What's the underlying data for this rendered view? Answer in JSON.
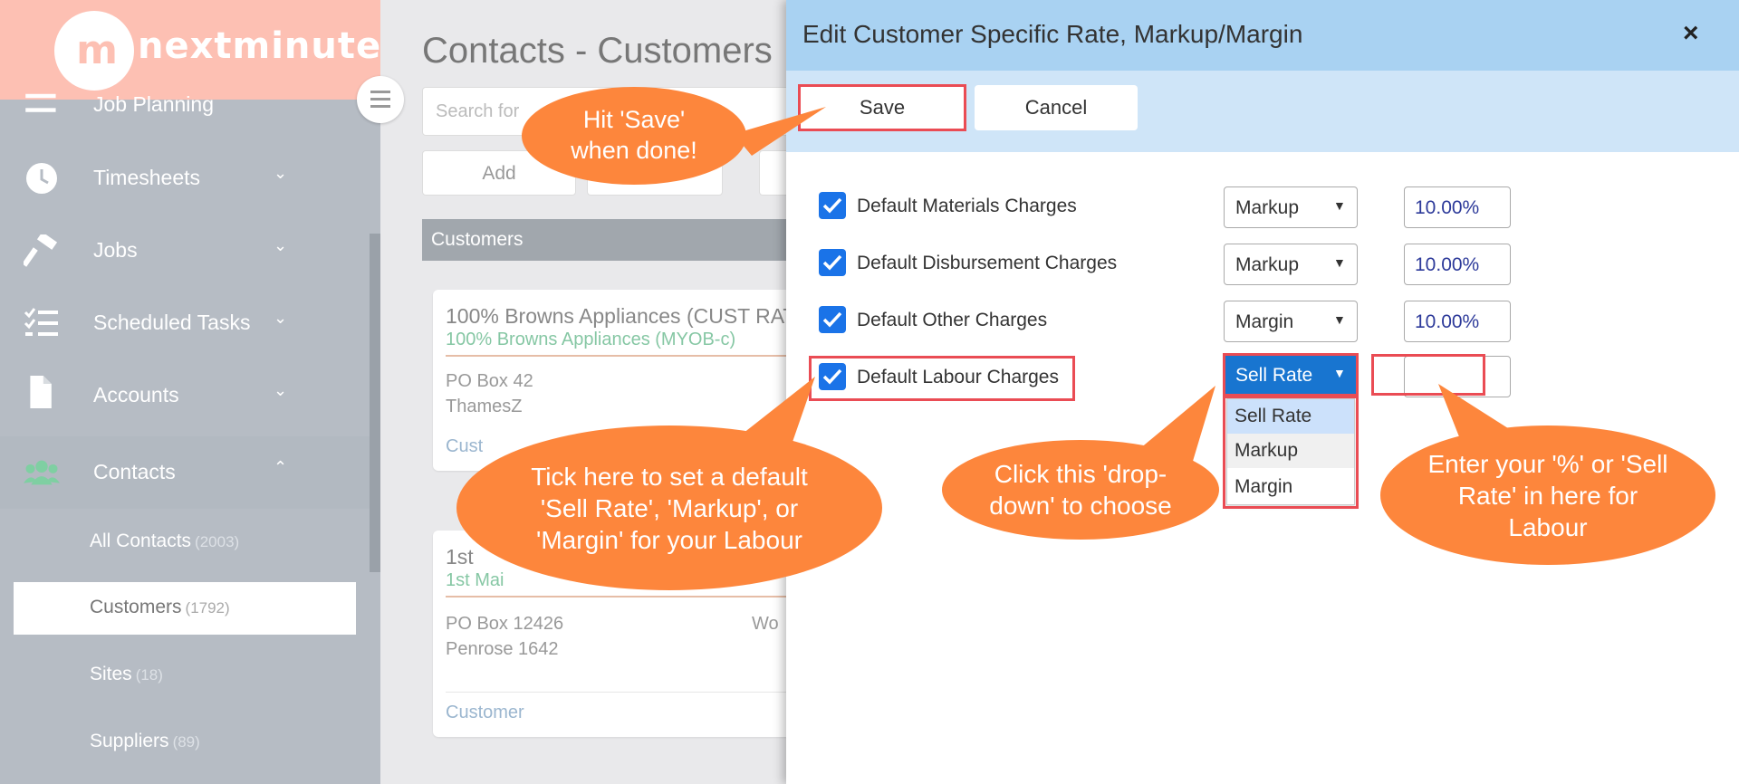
{
  "brand": {
    "logo_mark": "m",
    "name": "nextminute"
  },
  "sidebar": {
    "items": [
      {
        "label": "Job Planning",
        "icon": "menu-icon",
        "has_chevron": false
      },
      {
        "label": "Timesheets",
        "icon": "clock-icon",
        "chevron": "⌄"
      },
      {
        "label": "Jobs",
        "icon": "hammer-icon",
        "chevron": "⌄"
      },
      {
        "label": "Scheduled Tasks",
        "icon": "checklist-icon",
        "chevron": "⌄"
      },
      {
        "label": "Accounts",
        "icon": "document-icon",
        "chevron": "⌄"
      },
      {
        "label": "Contacts",
        "icon": "group-icon",
        "chevron": "⌃"
      }
    ],
    "sub_items": [
      {
        "label": "All Contacts",
        "count": "(2003)"
      },
      {
        "label": "Customers",
        "count": "(1792)",
        "active": true
      },
      {
        "label": "Sites",
        "count": "(18)"
      },
      {
        "label": "Suppliers",
        "count": "(89)"
      }
    ]
  },
  "main": {
    "page_title": "Contacts - Customers",
    "search_placeholder": "Search for",
    "add_label": "Add",
    "section_label": "Customers",
    "cards": [
      {
        "title": "100% Browns Appliances (CUST RAT",
        "subtitle": "100% Browns Appliances (MYOB-c)",
        "lines": [
          "PO Box 42",
          "ThamesZ"
        ],
        "footer": "Cust"
      },
      {
        "title": "1st",
        "subtitle": "1st Mai",
        "lines": [
          "PO Box 12426",
          "Penrose 1642"
        ],
        "extra": "Wo",
        "footer": "Customer"
      }
    ]
  },
  "modal": {
    "title": "Edit Customer Specific Rate, Markup/Margin",
    "close": "×",
    "save_label": "Save",
    "cancel_label": "Cancel",
    "rows": [
      {
        "label": "Default Materials Charges",
        "checked": true,
        "type": "Markup",
        "value": "10.00%"
      },
      {
        "label": "Default Disbursement Charges",
        "checked": true,
        "type": "Markup",
        "value": "10.00%"
      },
      {
        "label": "Default Other Charges",
        "checked": true,
        "type": "Margin",
        "value": "10.00%"
      },
      {
        "label": "Default Labour Charges",
        "checked": true,
        "type": "Sell Rate",
        "value": ""
      }
    ],
    "dropdown_arrow": "▼",
    "dropdown_options": [
      "Sell Rate",
      "Markup",
      "Margin"
    ]
  },
  "callouts": {
    "save": "Hit 'Save' when done!",
    "tick": "Tick here to set a default 'Sell Rate', 'Markup', or 'Margin' for your Labour",
    "dropdown": "Click this 'drop-down' to choose",
    "enter": "Enter your '%' or 'Sell Rate' in here for Labour"
  },
  "colors": {
    "callout": "#fd863c",
    "highlight": "#ea4c54",
    "modal_header": "#a9d2f2",
    "checkbox": "#1a73e8"
  }
}
